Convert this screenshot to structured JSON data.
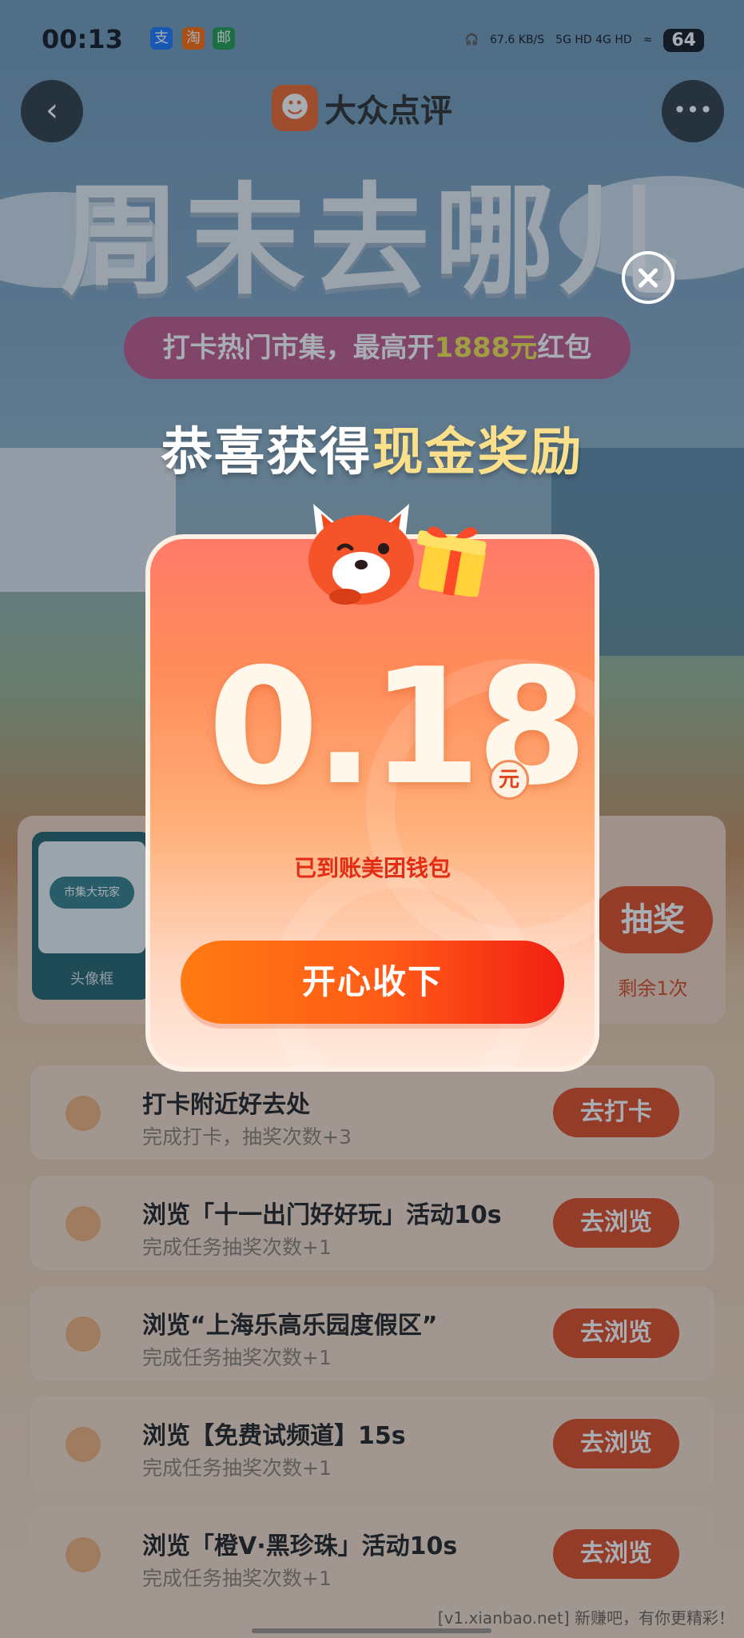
{
  "status_bar": {
    "time": "00:13",
    "apps": [
      "支",
      "淘",
      "邮"
    ],
    "speed": "67.6 KB/S",
    "network": "5G HD 4G HD",
    "battery": "64"
  },
  "header": {
    "brand_name": "大众点评",
    "page_title": "周末去哪儿",
    "subtitle_prefix": "打卡热门市集，最高开",
    "subtitle_highlight": "1888元",
    "subtitle_suffix": "红包"
  },
  "prize_area": {
    "card_label": "头像框",
    "card_badge": "市集大玩家",
    "draw_button": "抽奖",
    "draw_remaining": "剩余1次"
  },
  "tasks": [
    {
      "title": "打卡附近好去处",
      "desc": "完成打卡，抽奖次数+3",
      "button": "去打卡"
    },
    {
      "title": "浏览「十一出门好好玩」活动10s",
      "desc": "完成任务抽奖次数+1",
      "button": "去浏览"
    },
    {
      "title": "浏览“上海乐高乐园度假区”",
      "desc": "完成任务抽奖次数+1",
      "button": "去浏览"
    },
    {
      "title": "浏览【免费试频道】15s",
      "desc": "完成任务抽奖次数+1",
      "button": "去浏览"
    },
    {
      "title": "浏览「橙V·黑珍珠」活动10s",
      "desc": "完成任务抽奖次数+1",
      "button": "去浏览"
    }
  ],
  "modal": {
    "heading_prefix": "恭喜获得",
    "heading_highlight": "现金奖励",
    "amount": "0.18",
    "unit": "元",
    "credited_text": "已到账美团钱包",
    "accept_button": "开心收下"
  },
  "watermark": "[v1.xianbao.net] 新赚吧，有你更精彩！",
  "colors": {
    "accent": "#e04a1f",
    "card_top": "#ff7a68",
    "card_bottom": "#ffe9dc",
    "gold": "#fbe08b"
  }
}
